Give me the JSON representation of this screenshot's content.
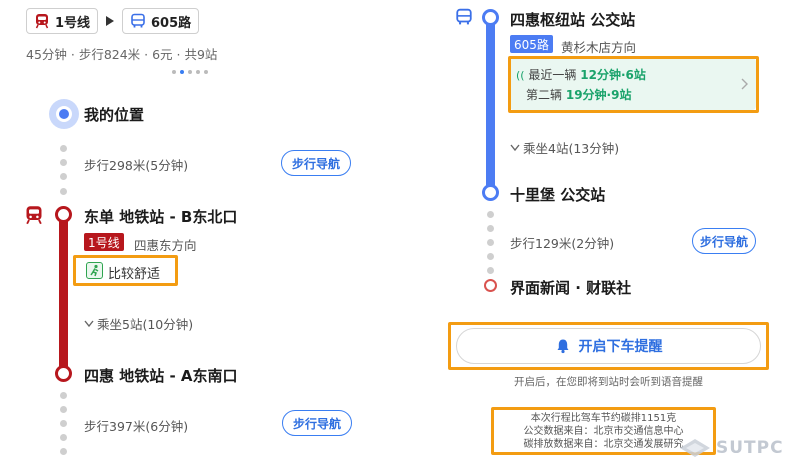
{
  "left": {
    "route": {
      "chip1_label": "1号线",
      "chip2_label": "605路",
      "summary": "45分钟 · 步行824米 · 6元 · 共9站"
    },
    "my_location": "我的位置",
    "walk1": {
      "text": "步行298米(5分钟)",
      "nav": "步行导航"
    },
    "station1": {
      "title": "东单 地铁站 - B东北口",
      "line_badge": "1号线",
      "direction": "四惠东方向",
      "comfort": "比较舒适"
    },
    "ride": "乘坐5站(10分钟)",
    "station2": {
      "title": "四惠 地铁站 - A东南口"
    },
    "walk2": {
      "text": "步行397米(6分钟)",
      "nav": "步行导航"
    }
  },
  "right": {
    "stop1": {
      "title": "四惠枢纽站 公交站",
      "bus_badge": "605路",
      "direction": "黄杉木店方向"
    },
    "arrivals": {
      "first_label": "最近一辆",
      "first_value": "12分钟·6站",
      "second_label": "第二辆",
      "second_value": "19分钟·9站"
    },
    "ride": "乘坐4站(13分钟)",
    "stop2": {
      "title": "十里堡 公交站"
    },
    "walk": {
      "text": "步行129米(2分钟)",
      "nav": "步行导航"
    },
    "destination": "界面新闻 · 财联社",
    "alert_button": "开启下车提醒",
    "alert_hint": "开启后，在您即将到站时会听到语音提醒",
    "footer": {
      "line1": "本次行程比驾车节约碳排1151克",
      "line2": "公交数据来自：北京市交通信息中心",
      "line3": "碳排放数据来自：北京交通发展研究"
    }
  },
  "watermark": "SUTPC",
  "colors": {
    "subway_red": "#b7171d",
    "bus_blue": "#4c7cf3",
    "highlight_orange": "#f39c12",
    "arrival_green": "#1aa36b",
    "link_blue": "#2f6fe0"
  }
}
